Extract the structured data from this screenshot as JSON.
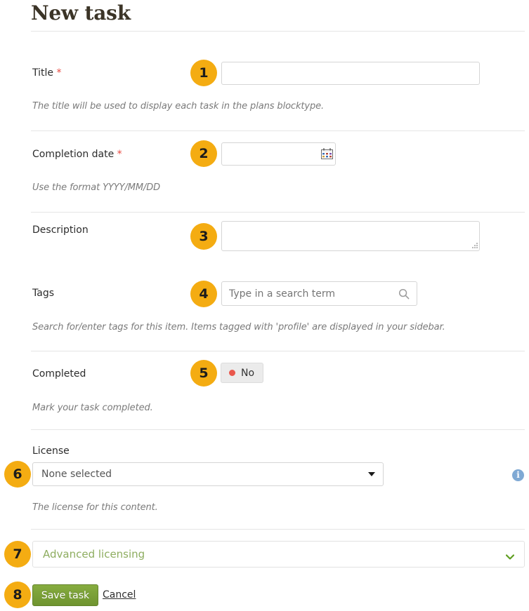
{
  "page": {
    "title": "New task"
  },
  "fields": {
    "title": {
      "label": "Title",
      "required_mark": "*",
      "value": "",
      "help": "The title will be used to display each task in the plans blocktype."
    },
    "completion_date": {
      "label": "Completion date",
      "required_mark": "*",
      "value": "",
      "help": "Use the format YYYY/MM/DD",
      "icon": "calendar-icon"
    },
    "description": {
      "label": "Description",
      "value": ""
    },
    "tags": {
      "label": "Tags",
      "value": "",
      "placeholder": "Type in a search term",
      "help": "Search for/enter tags for this item. Items tagged with 'profile' are displayed in your sidebar.",
      "icon": "search-icon"
    },
    "completed": {
      "label": "Completed",
      "toggle_value": "No",
      "help": "Mark your task completed.",
      "dot_color": "#e9574c"
    },
    "license": {
      "label": "License",
      "selected": "None selected",
      "help": "The license for this content.",
      "info_icon": "info-icon"
    },
    "advanced_licensing": {
      "label": "Advanced licensing",
      "chevron": "chevron-down-icon"
    }
  },
  "actions": {
    "save_label": "Save task",
    "cancel_label": "Cancel"
  },
  "callouts": [
    {
      "number": "1"
    },
    {
      "number": "2"
    },
    {
      "number": "3"
    },
    {
      "number": "4"
    },
    {
      "number": "5"
    },
    {
      "number": "6"
    },
    {
      "number": "7"
    },
    {
      "number": "8"
    }
  ],
  "colors": {
    "badge": "#f4ac12",
    "save_button": "#7a9f36",
    "accent_green": "#8ead60",
    "required": "#e8483f",
    "info": "#7fa9d4"
  }
}
